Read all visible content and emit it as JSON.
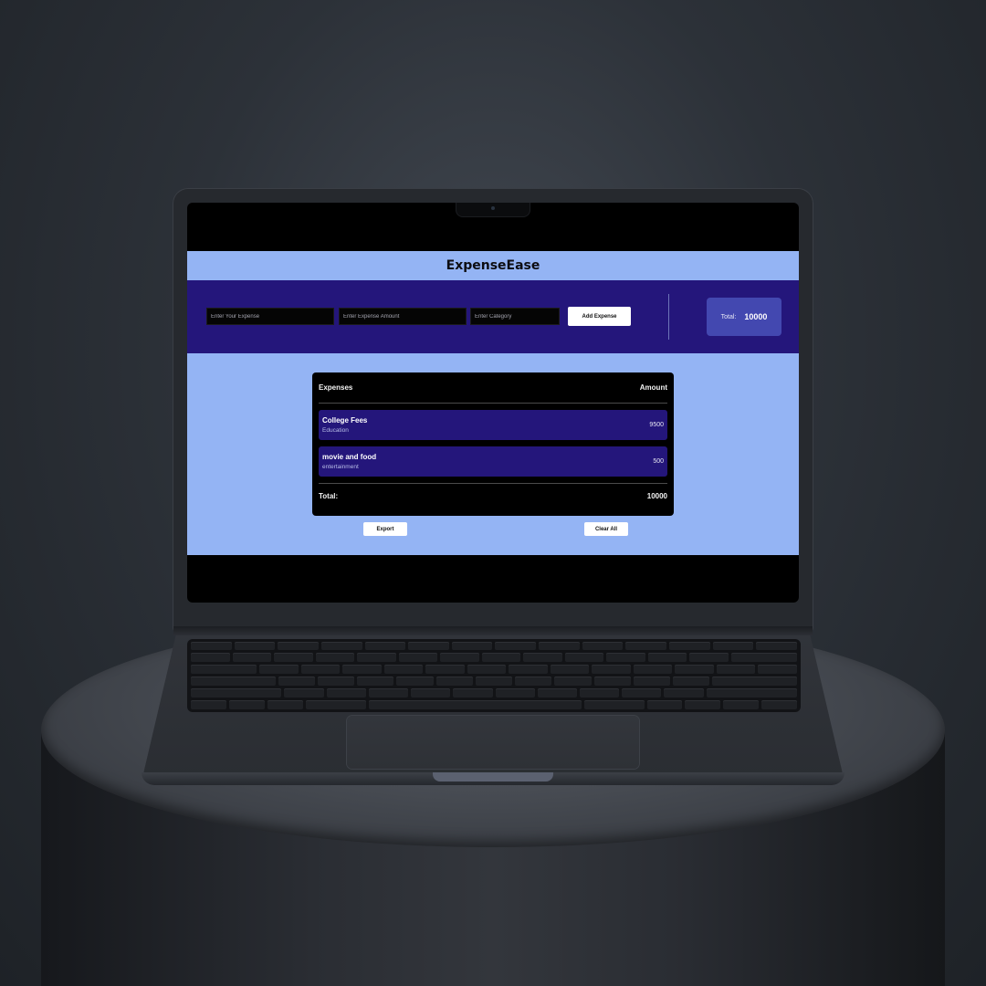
{
  "app": {
    "title": "ExpenseEase"
  },
  "form": {
    "expense_placeholder": "Enter Your Expense",
    "amount_placeholder": "Enter Expense Amount",
    "category_placeholder": "Enter Category",
    "add_button": "Add Expense"
  },
  "summary": {
    "total_label": "Total:",
    "total_value": "10000"
  },
  "table": {
    "header_expenses": "Expenses",
    "header_amount": "Amount",
    "rows": [
      {
        "name": "College Fees",
        "category": "Education",
        "amount": "9500"
      },
      {
        "name": "movie and food",
        "category": "entertainment",
        "amount": "500"
      }
    ],
    "footer_label": "Total:",
    "footer_value": "10000"
  },
  "actions": {
    "export": "Export",
    "clear_all": "Clear All"
  },
  "colors": {
    "header_bg": "#94b4f4",
    "toolbar_bg": "#24167b",
    "total_card_bg": "#4348b0",
    "panel_bg": "#000000"
  }
}
